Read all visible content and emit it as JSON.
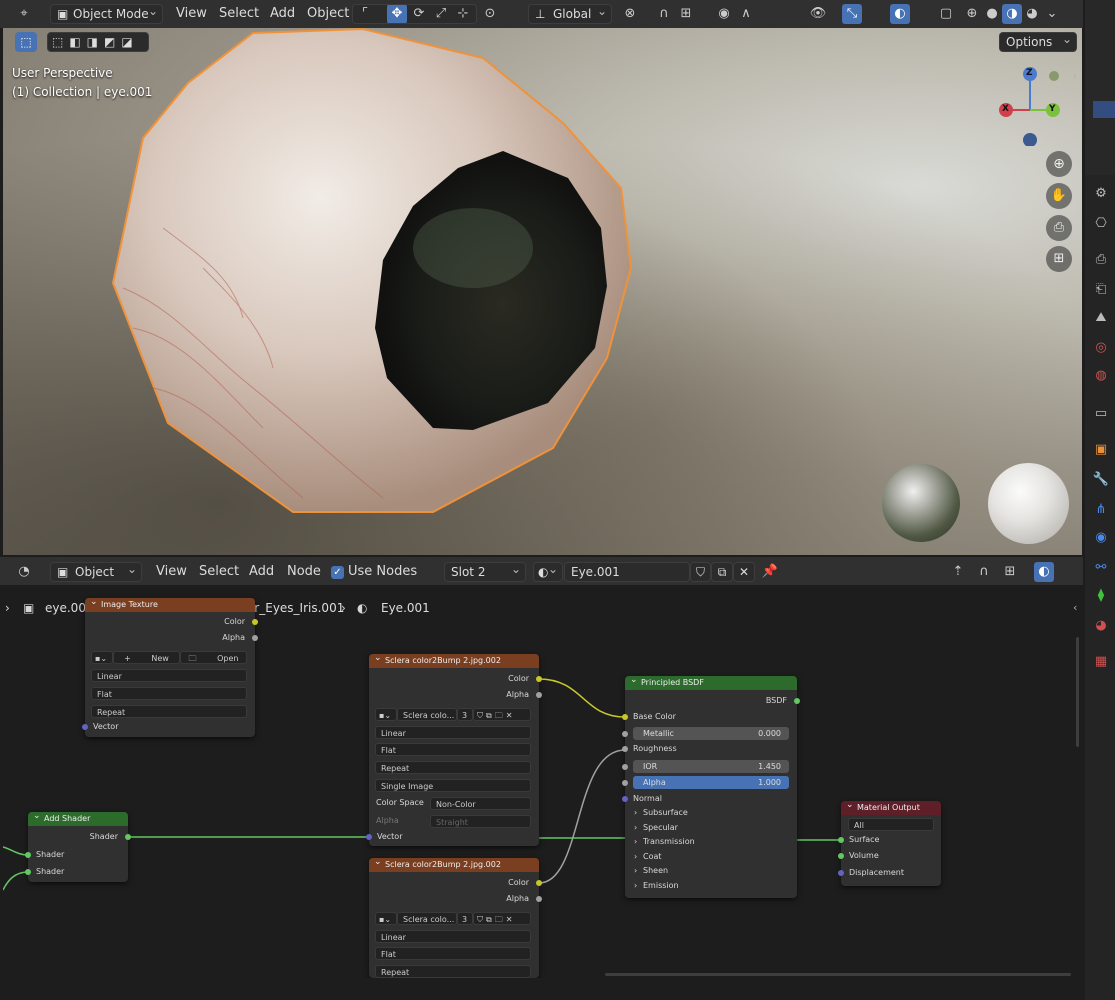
{
  "top_header": {
    "mode": "Object Mode",
    "menus": [
      "View",
      "Select",
      "Add",
      "Object"
    ],
    "orientation": "Global",
    "options_label": "Options"
  },
  "viewport": {
    "perspective": "User Perspective",
    "collection": "(1) Collection | eye.001",
    "gizmo": {
      "z": "Z",
      "x": "X",
      "y": "Y"
    }
  },
  "node_header": {
    "editor_type": "Object",
    "menus": [
      "View",
      "Select",
      "Add",
      "Node"
    ],
    "use_nodes_label": "Use Nodes",
    "slot": "Slot 2",
    "material": "Eye.001"
  },
  "breadcrumb": {
    "object": "eye.001",
    "mesh": "Data_Widowmaker_Eyes_Iris.001",
    "material": "Eye.001"
  },
  "nodes": {
    "image_texture": {
      "title": "Image Texture",
      "out_color": "Color",
      "out_alpha": "Alpha",
      "new_label": "New",
      "open_label": "Open",
      "interpolation": "Linear",
      "projection": "Flat",
      "extension": "Repeat",
      "in_vector": "Vector"
    },
    "sclera1": {
      "title": "Sclera color2Bump 2.jpg.002",
      "out_color": "Color",
      "out_alpha": "Alpha",
      "image_name": "Sclera colo...",
      "users": "3",
      "interpolation": "Linear",
      "projection": "Flat",
      "extension": "Repeat",
      "source": "Single Image",
      "color_space_label": "Color Space",
      "color_space": "Non-Color",
      "alpha_label": "Alpha",
      "alpha_value": "Straight",
      "in_vector": "Vector"
    },
    "sclera2": {
      "title": "Sclera color2Bump 2.jpg.002",
      "out_color": "Color",
      "out_alpha": "Alpha",
      "image_name": "Sclera colo...",
      "users": "3",
      "interpolation": "Linear",
      "projection": "Flat",
      "extension": "Repeat"
    },
    "add_shader": {
      "title": "Add Shader",
      "out_shader": "Shader",
      "in_shader1": "Shader",
      "in_shader2": "Shader"
    },
    "bsdf": {
      "title": "Principled BSDF",
      "out": "BSDF",
      "base_color": "Base Color",
      "metallic_label": "Metallic",
      "metallic": "0.000",
      "roughness": "Roughness",
      "ior_label": "IOR",
      "ior": "1.450",
      "alpha_label": "Alpha",
      "alpha": "1.000",
      "normal": "Normal",
      "panels": [
        "Subsurface",
        "Specular",
        "Transmission",
        "Coat",
        "Sheen",
        "Emission"
      ]
    },
    "material_output": {
      "title": "Material Output",
      "target": "All",
      "surface": "Surface",
      "volume": "Volume",
      "displacement": "Displacement"
    }
  },
  "colors": {
    "selection_orange": "#f0923a",
    "image_node_header": "#7a3e20",
    "shader_node_header": "#2d6b2d",
    "output_node_header": "#5e1f28",
    "socket_yellow": "#c7c729",
    "socket_green": "#63c763",
    "socket_grey": "#a1a1a1",
    "socket_violet": "#6363c7",
    "accent_blue": "#4772b3"
  }
}
